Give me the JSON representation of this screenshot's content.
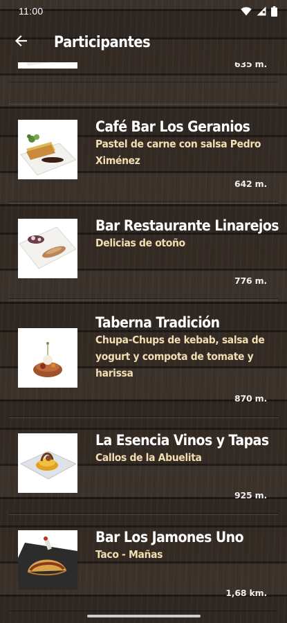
{
  "status_bar": {
    "time": "11:00",
    "icons": [
      "wifi-icon",
      "signal-icon",
      "battery-icon"
    ]
  },
  "app_bar": {
    "back_icon": "back-arrow-icon",
    "title": "Participantes"
  },
  "participants": [
    {
      "name": "",
      "dish": "",
      "distance": "635 m.",
      "image": "plated-dish-photo"
    },
    {
      "name": "Café Bar Los Geranios",
      "dish": "Pastel de carne con salsa Pedro Ximénez",
      "distance": "642 m.",
      "image": "meat-pie-photo"
    },
    {
      "name": "Bar Restaurante Linarejos",
      "dish": "Delicias de otoño",
      "distance": "776 m.",
      "image": "autumn-dish-photo"
    },
    {
      "name": "Taberna Tradición",
      "dish": "Chupa-Chups de kebab, salsa de yogurt y compota de tomate y harissa",
      "distance": "870 m.",
      "image": "kebab-lollipop-photo"
    },
    {
      "name": "La Esencia Vinos y Tapas",
      "dish": "Callos de la Abuelita",
      "distance": "925 m.",
      "image": "callos-photo"
    },
    {
      "name": "Bar Los Jamones Uno",
      "dish": "Taco - Mañas",
      "distance": "1,68 km.",
      "image": "taco-photo"
    }
  ],
  "colors": {
    "title_text": "#ffffff",
    "dish_text": "#f1deb3",
    "background_wood": "#2f2722"
  }
}
